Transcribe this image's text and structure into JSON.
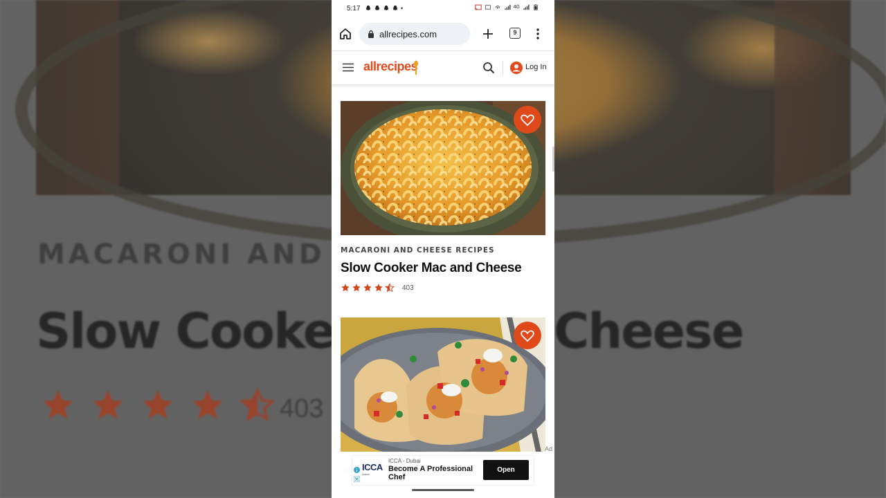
{
  "status_bar": {
    "time": "5:17",
    "dot": "•",
    "net": "4G"
  },
  "browser": {
    "url": "allrecipes.com",
    "tab_count": "9"
  },
  "site_header": {
    "logo": "allrecipes",
    "login_label": "Log In"
  },
  "cards": [
    {
      "category": "MACARONI AND CHEESE RECIPES",
      "title": "Slow Cooker Mac and Cheese",
      "rating": 4.5,
      "rating_count": "403"
    },
    {
      "category": "",
      "title": "",
      "rating": null,
      "rating_count": ""
    }
  ],
  "ad": {
    "label": "Ad",
    "logo": "ICCA",
    "logo_sub": "Dubai",
    "advertiser": "ICCA - Dubai",
    "headline": "Become A Professional Chef",
    "cta": "Open"
  },
  "background": {
    "category": "MACARONI AND CH",
    "title_left": "Slow Cooker",
    "title_right": "Cheese",
    "count": "403"
  },
  "colors": {
    "brand": "#e34a1b",
    "star": "#d4441b"
  }
}
